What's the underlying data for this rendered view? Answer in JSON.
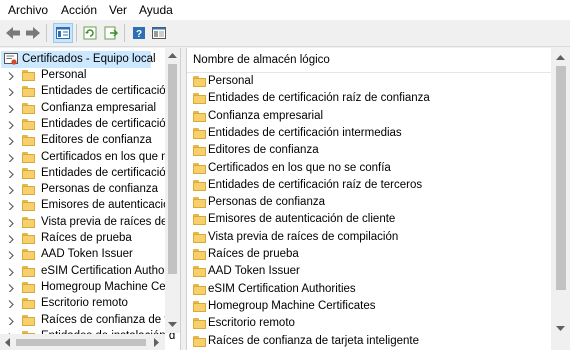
{
  "menu": [
    "Archivo",
    "Acción",
    "Ver",
    "Ayuda"
  ],
  "toolbar": {
    "icons": [
      "back-arrow-icon",
      "forward-arrow-icon",
      "show-hide-tree-icon",
      "refresh-icon",
      "export-list-icon",
      "help-icon",
      "properties-icon"
    ]
  },
  "tree": {
    "root": "Certificados - Equipo local",
    "items": [
      "Personal",
      "Entidades de certificación",
      "Confianza empresarial",
      "Entidades de certificación",
      "Editores de confianza",
      "Certificados en los que no",
      "Entidades de certificación",
      "Personas de confianza",
      "Emisores de autenticación",
      "Vista previa de raíces de",
      "Raíces de prueba",
      "AAD Token Issuer",
      "eSIM Certification Authori",
      "Homegroup Machine Cer",
      "Escritorio remoto",
      "Raíces de confianza de tar",
      "Entidades de instalación d"
    ]
  },
  "list": {
    "header": "Nombre de almacén lógico",
    "items": [
      "Personal",
      "Entidades de certificación raíz de confianza",
      "Confianza empresarial",
      "Entidades de certificación intermedias",
      "Editores de confianza",
      "Certificados en los que no se confía",
      "Entidades de certificación raíz de terceros",
      "Personas de confianza",
      "Emisores de autenticación de cliente",
      "Vista previa de raíces de compilación",
      "Raíces de prueba",
      "AAD Token Issuer",
      "eSIM Certification Authorities",
      "Homegroup Machine Certificates",
      "Escritorio remoto",
      "Raíces de confianza de tarjeta inteligente"
    ]
  },
  "colors": {
    "selection": "#cce8ff",
    "folder": "#f7cf6b",
    "accent": "#0078d7"
  }
}
